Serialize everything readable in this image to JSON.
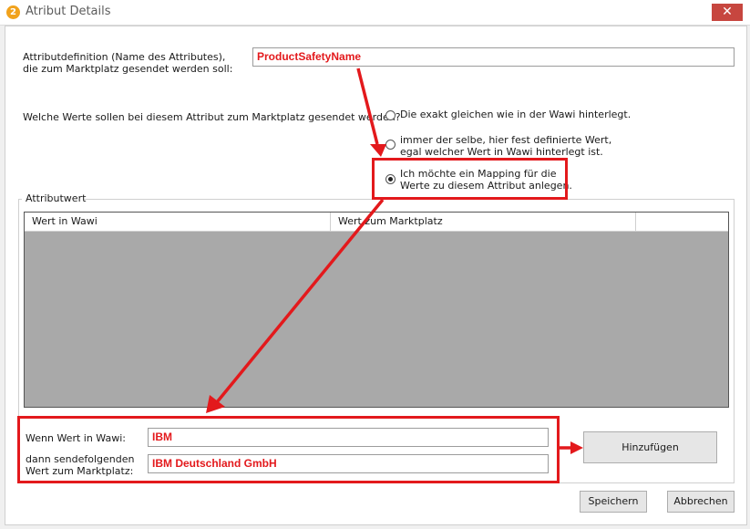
{
  "window": {
    "title": "Atribut Details",
    "close_symbol": "✕",
    "app_icon_glyph": "2"
  },
  "definition": {
    "label_line1": "Attributdefinition (Name des Attributes),",
    "label_line2": "die zum Marktplatz gesendet werden soll:",
    "value": "ProductSafetyName"
  },
  "question": "Welche Werte sollen bei diesem Attribut zum Marktplatz gesendet werden?",
  "options": [
    {
      "line1": "Die exakt gleichen wie in der Wawi hinterlegt.",
      "line2": "",
      "selected": false
    },
    {
      "line1": "immer der selbe, hier fest definierte Wert,",
      "line2": "egal welcher Wert in Wawi hinterlegt ist.",
      "selected": false
    },
    {
      "line1": "Ich möchte ein Mapping für die",
      "line2": "Werte zu diesem Attribut anlegen.",
      "selected": true
    }
  ],
  "group": {
    "title": "Attributwert"
  },
  "table": {
    "columns": [
      "Wert in Wawi",
      "Wert zum Marktplatz",
      ""
    ],
    "rows": []
  },
  "mapping": {
    "wawi_label": "Wenn Wert in Wawi:",
    "wawi_value": "IBM",
    "market_label_line1": "dann sendefolgenden",
    "market_label_line2": "Wert zum Marktplatz:",
    "market_value": "IBM Deutschland GmbH"
  },
  "buttons": {
    "add": "Hinzufügen",
    "save": "Speichern",
    "cancel": "Abbrechen"
  },
  "colors": {
    "highlight": "#e3191c",
    "close": "#c7463f",
    "grid_bg": "#a9a9a9"
  }
}
